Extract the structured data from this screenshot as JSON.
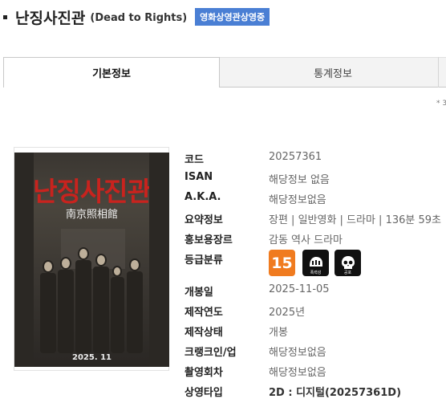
{
  "header": {
    "title": "난징사진관",
    "subtitle": "(Dead to Rights)",
    "badge": "영화상영관상영중"
  },
  "tabs": [
    {
      "label": "기본정보",
      "active": true
    },
    {
      "label": "통계정보",
      "active": false
    }
  ],
  "note": "* 3",
  "poster": {
    "title": "난징사진관",
    "subtitle": "南京照相館",
    "date": "2025. 11"
  },
  "fields": [
    {
      "label": "코드",
      "value": "20257361"
    },
    {
      "label": "ISAN",
      "value": "해당정보 없음"
    },
    {
      "label": "A.K.A.",
      "value": "해당정보없음"
    },
    {
      "label": "요약정보",
      "value": "장편 | 일반영화 | 드라마 | 136분 59초"
    },
    {
      "label": "홍보용장르",
      "value": "감동 역사 드라마"
    },
    {
      "label": "등급분류",
      "value": ""
    },
    {
      "label": "개봉일",
      "value": "2025-11-05"
    },
    {
      "label": "제작연도",
      "value": "2025년"
    },
    {
      "label": "제작상태",
      "value": "개봉"
    },
    {
      "label": "크랭크인/업",
      "value": "해당정보없음"
    },
    {
      "label": "촬영회차",
      "value": "해당정보없음"
    },
    {
      "label": "상영타입",
      "value": "2D : 디지털(20257361D)"
    }
  ],
  "rating": {
    "age": "15",
    "icons": [
      {
        "name": "fear-icon",
        "label": "폭력성"
      },
      {
        "name": "skull-icon",
        "label": "공포"
      }
    ]
  },
  "colors": {
    "badge": "#4a7fd4",
    "rating_15": "#f07b1f",
    "icon_bg": "#111111"
  }
}
